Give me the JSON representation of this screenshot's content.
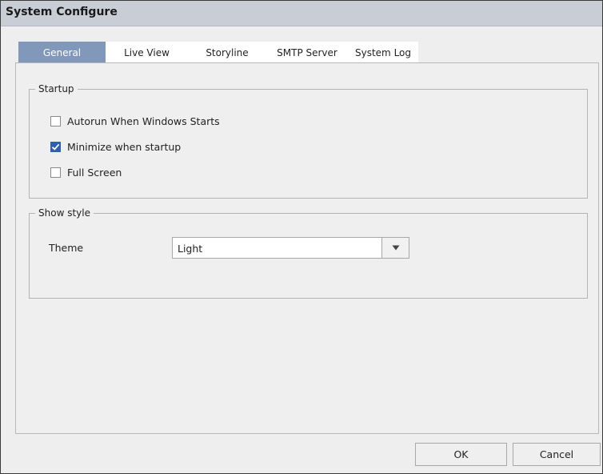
{
  "window": {
    "title": "System Configure"
  },
  "tabs": [
    {
      "label": "General"
    },
    {
      "label": "Live View"
    },
    {
      "label": "Storyline"
    },
    {
      "label": "SMTP Server"
    },
    {
      "label": "System Log"
    }
  ],
  "active_tab": "General",
  "startup": {
    "legend": "Startup",
    "options": [
      {
        "label": "Autorun When Windows Starts",
        "checked": false
      },
      {
        "label": "Minimize when startup",
        "checked": true
      },
      {
        "label": "Full Screen",
        "checked": false
      }
    ]
  },
  "show_style": {
    "legend": "Show style",
    "theme_label": "Theme",
    "theme_value": "Light"
  },
  "buttons": {
    "ok": "OK",
    "cancel": "Cancel"
  },
  "colors": {
    "titlebar": "#c9cdd6",
    "active_tab": "#8298bb",
    "checkbox_checked": "#2e5fb0",
    "background": "#eeeeee"
  }
}
